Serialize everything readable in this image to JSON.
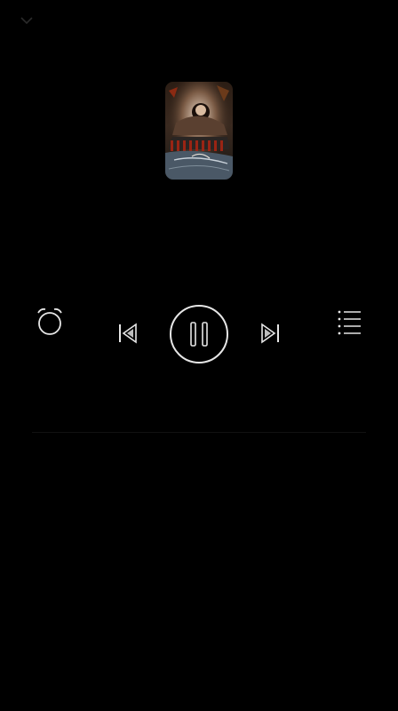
{
  "player": {
    "back_icon": "chevron-down-icon",
    "album_art_icon": "album-cover-image",
    "song_title": "",
    "alarm_label": "",
    "playlist_label": "",
    "prev_icon": "skip-previous-icon",
    "play_pause_icon": "pause-icon",
    "next_icon": "skip-next-icon",
    "alarm_icon": "alarm-clock-icon",
    "playlist_icon": "list-icon"
  },
  "colors": {
    "background": "#000000",
    "foreground": "#d8d8d8",
    "dim_text": "#555555"
  }
}
